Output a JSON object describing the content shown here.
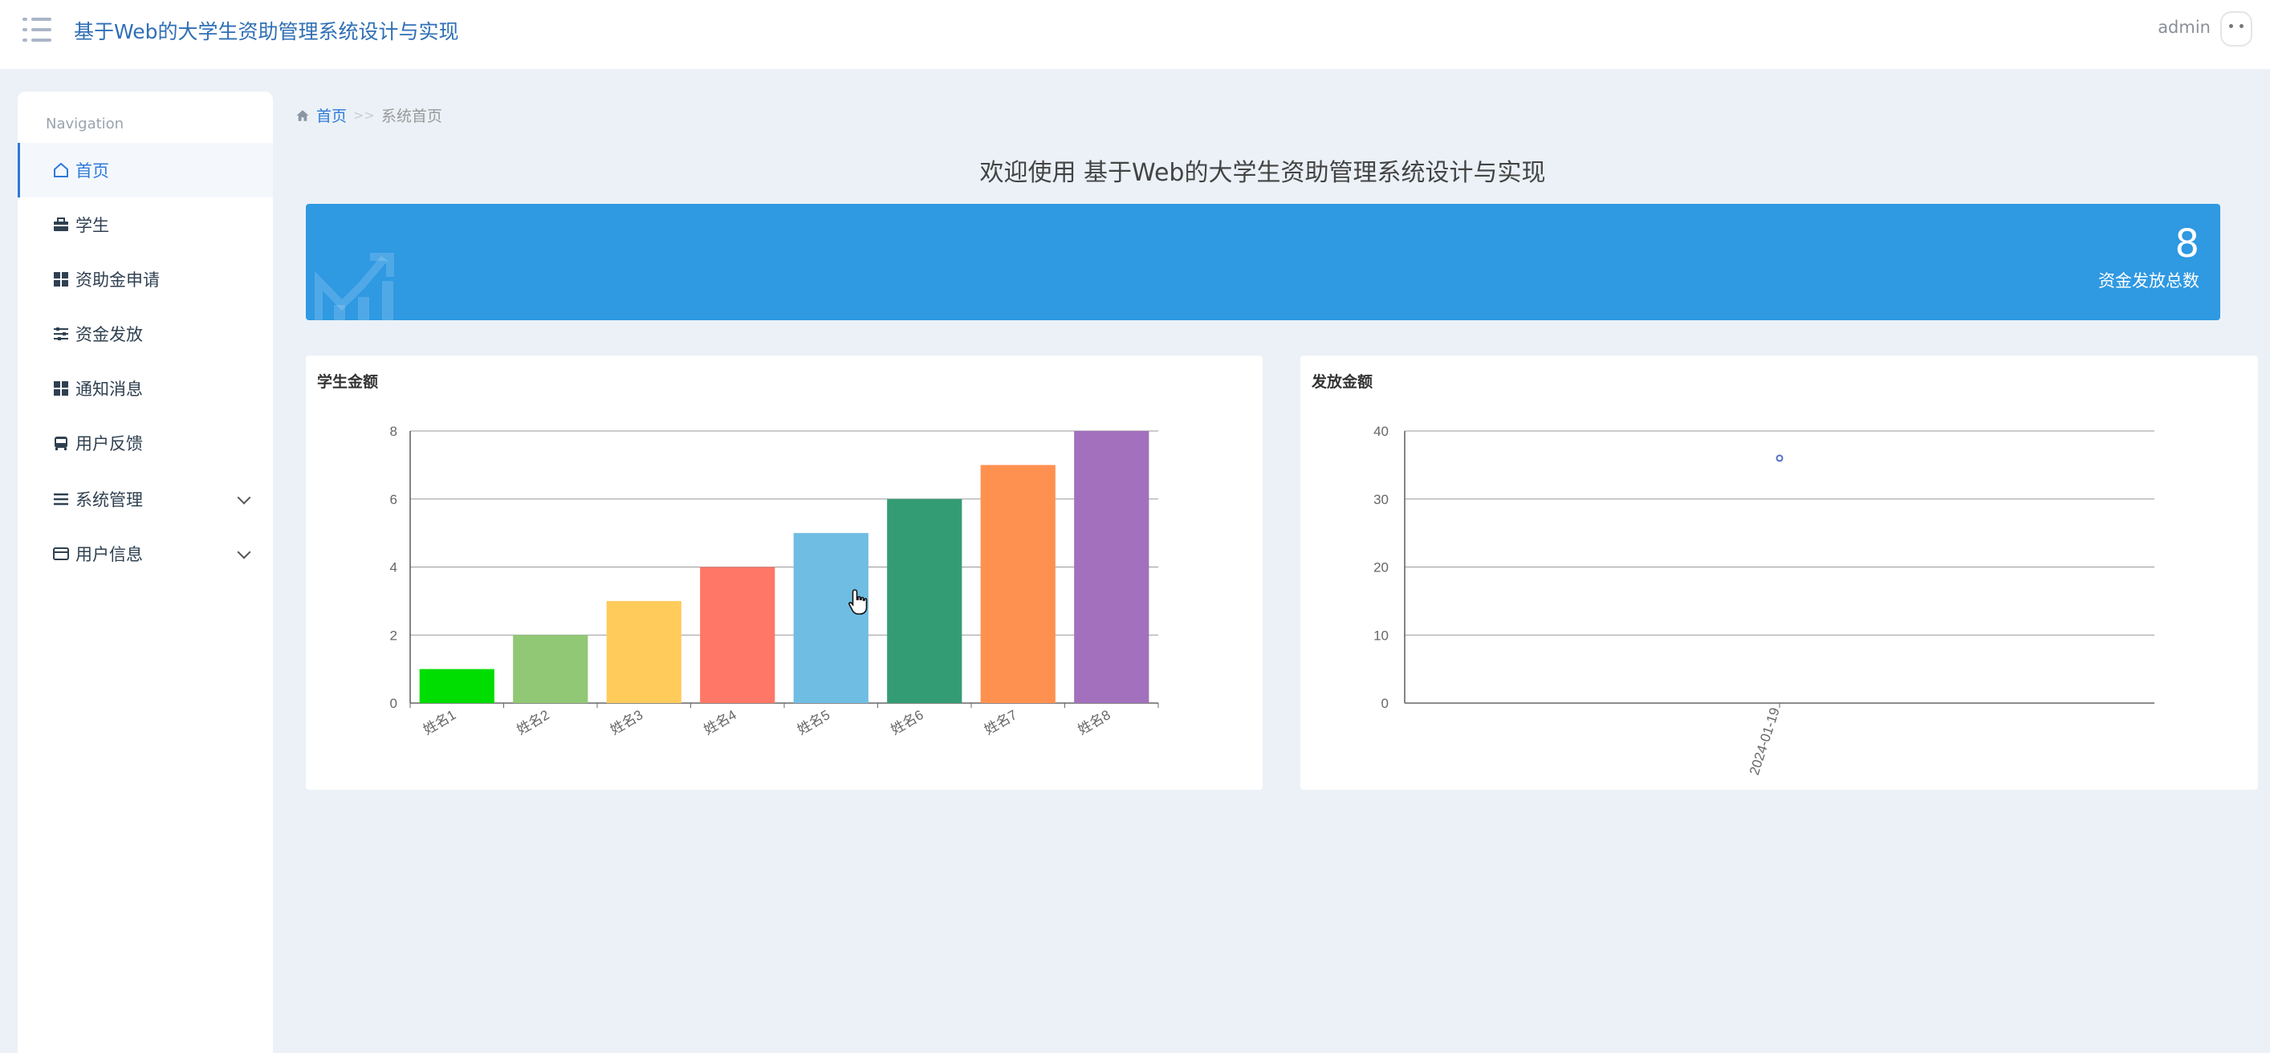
{
  "header": {
    "title": "基于Web的大学生资助管理系统设计与实现",
    "user": "admin",
    "menu_icon": "menu-icon",
    "avatar_icon": "avatar-icon"
  },
  "sidebar": {
    "heading": "Navigation",
    "items": [
      {
        "label": "首页",
        "icon": "home-icon",
        "active": true
      },
      {
        "label": "学生",
        "icon": "briefcase-icon"
      },
      {
        "label": "资助金申请",
        "icon": "grid-icon"
      },
      {
        "label": "资金发放",
        "icon": "sliders-icon"
      },
      {
        "label": "通知消息",
        "icon": "grid-icon"
      },
      {
        "label": "用户反馈",
        "icon": "bus-icon"
      },
      {
        "label": "系统管理",
        "icon": "list-icon",
        "expandable": true
      },
      {
        "label": "用户信息",
        "icon": "card-icon",
        "expandable": true
      }
    ]
  },
  "breadcrumb": {
    "home": "首页",
    "separator": ">>",
    "current": "系统首页"
  },
  "welcome": "欢迎使用 基于Web的大学生资助管理系统设计与实现",
  "stat_card": {
    "value": "8",
    "label": "资金发放总数",
    "color": "#2f99e2"
  },
  "chart_data": [
    {
      "type": "bar",
      "title": "学生金额",
      "categories": [
        "姓名1",
        "姓名2",
        "姓名3",
        "姓名4",
        "姓名5",
        "姓名6",
        "姓名7",
        "姓名8"
      ],
      "values": [
        1,
        2,
        3,
        4,
        5,
        6,
        7,
        8
      ],
      "colors": [
        "#00dd00",
        "#91c875",
        "#ffcc5c",
        "#ff7766",
        "#6fbde3",
        "#349c74",
        "#ff9150",
        "#a270bc"
      ],
      "ylim": [
        0,
        8
      ],
      "yticks": [
        0,
        2,
        4,
        6,
        8
      ],
      "grid": true
    },
    {
      "type": "line",
      "title": "发放金额",
      "x": [
        "2024-01-19"
      ],
      "values": [
        36
      ],
      "ylim": [
        0,
        40
      ],
      "yticks": [
        0,
        10,
        20,
        30,
        40
      ],
      "grid": true,
      "color": "#5470c6"
    }
  ]
}
